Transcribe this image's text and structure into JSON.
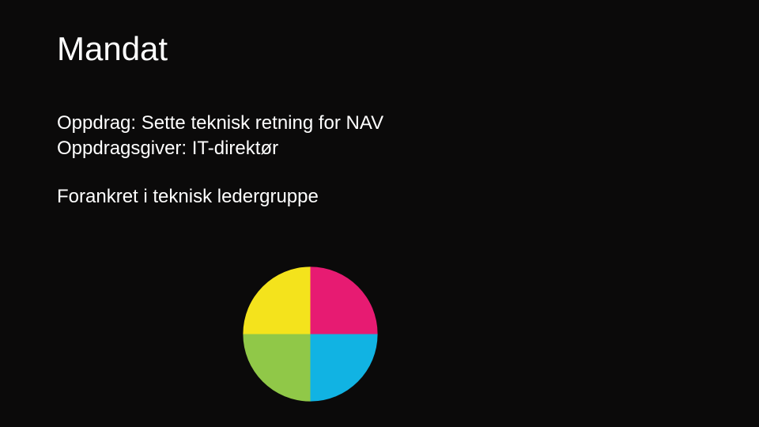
{
  "title": "Mandat",
  "lines": {
    "l1": "Oppdrag: Sette teknisk retning for NAV",
    "l2": "Oppdragsgiver: IT-direktør",
    "l3": "Forankret i teknisk ledergruppe"
  },
  "chart_data": {
    "type": "pie",
    "title": "",
    "categories": [
      "Yellow",
      "Magenta",
      "Cyan",
      "Green"
    ],
    "values": [
      25,
      25,
      25,
      25
    ],
    "series": [
      {
        "name": "Yellow",
        "value": 25,
        "color": "#f4e31c"
      },
      {
        "name": "Magenta",
        "value": 25,
        "color": "#e71b72"
      },
      {
        "name": "Cyan",
        "value": 25,
        "color": "#11b3e3"
      },
      {
        "name": "Green",
        "value": 25,
        "color": "#90c848"
      }
    ],
    "legend": false
  }
}
